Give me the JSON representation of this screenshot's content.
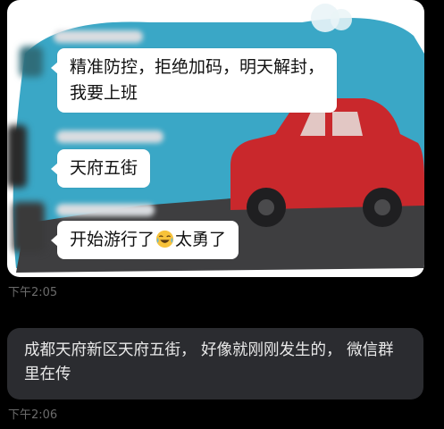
{
  "screenshot": {
    "messages": [
      {
        "line1": "精准防控，拒绝加码，明天解封，",
        "line2": "我要上班"
      },
      {
        "text": "天府五街"
      },
      {
        "text_before": "开始游行了",
        "emoji": "crying-laughing-emoji",
        "text_after": "太勇了"
      }
    ],
    "colors": {
      "sky": "#3aa7c6",
      "car": "#c9282c",
      "road": "#3e3e40"
    }
  },
  "chat": {
    "time_1": "下午2:05",
    "message": "成都天府新区天府五街， 好像就刚刚发生的， 微信群里在传",
    "time_2": "下午2:06"
  },
  "colors": {
    "background": "#000000",
    "bubble": "#2b2c30",
    "timestamp": "#6b6b6b"
  }
}
